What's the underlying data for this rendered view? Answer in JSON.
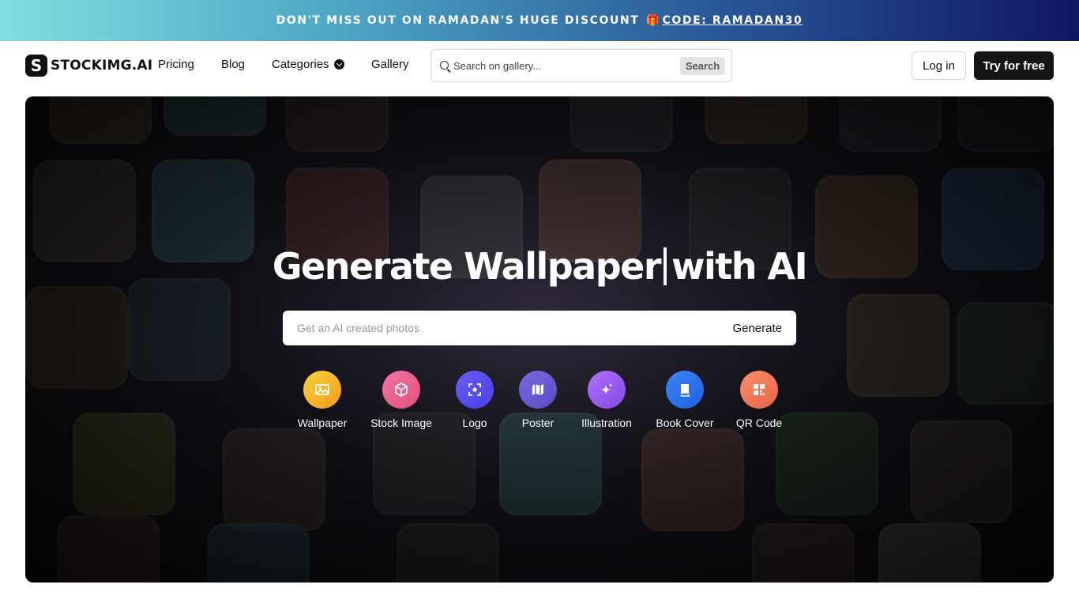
{
  "promo": {
    "text": "DON'T MISS OUT ON RAMADAN'S HUGE DISCOUNT",
    "gift_emoji": "🎁",
    "code_label": "CODE: RAMADAN30"
  },
  "nav": {
    "logo_mark": "S",
    "logo_text": "STOCKIMG.AI",
    "links": [
      "Pricing",
      "Blog",
      "Categories",
      "Gallery"
    ],
    "search_placeholder": "Search on gallery...",
    "search_button": "Search",
    "login": "Log in",
    "try_free": "Try for free"
  },
  "hero": {
    "title_before": "Generate Wallpaper",
    "title_after": "with AI",
    "input_placeholder": "Get an AI created photos",
    "generate_button": "Generate",
    "categories": [
      {
        "label": "Wallpaper",
        "icon": "image-icon",
        "color": "#f5b12b"
      },
      {
        "label": "Stock Image",
        "icon": "cube-icon",
        "color": "#ec5f8b"
      },
      {
        "label": "Logo",
        "icon": "focus-icon",
        "color": "#5b4ff0"
      },
      {
        "label": "Poster",
        "icon": "map-icon",
        "color": "#6b5bd1"
      },
      {
        "label": "Illustration",
        "icon": "sparkle-icon",
        "color": "#9b59f0"
      },
      {
        "label": "Book Cover",
        "icon": "book-icon",
        "color": "#2f73ef"
      },
      {
        "label": "QR Code",
        "icon": "qr-icon",
        "color": "#f2795a"
      }
    ]
  },
  "colors": {
    "banner_start": "#7fdfe0",
    "banner_end": "#0f1763",
    "primary_button": "#151515",
    "hero_background": "#1c1a24"
  }
}
